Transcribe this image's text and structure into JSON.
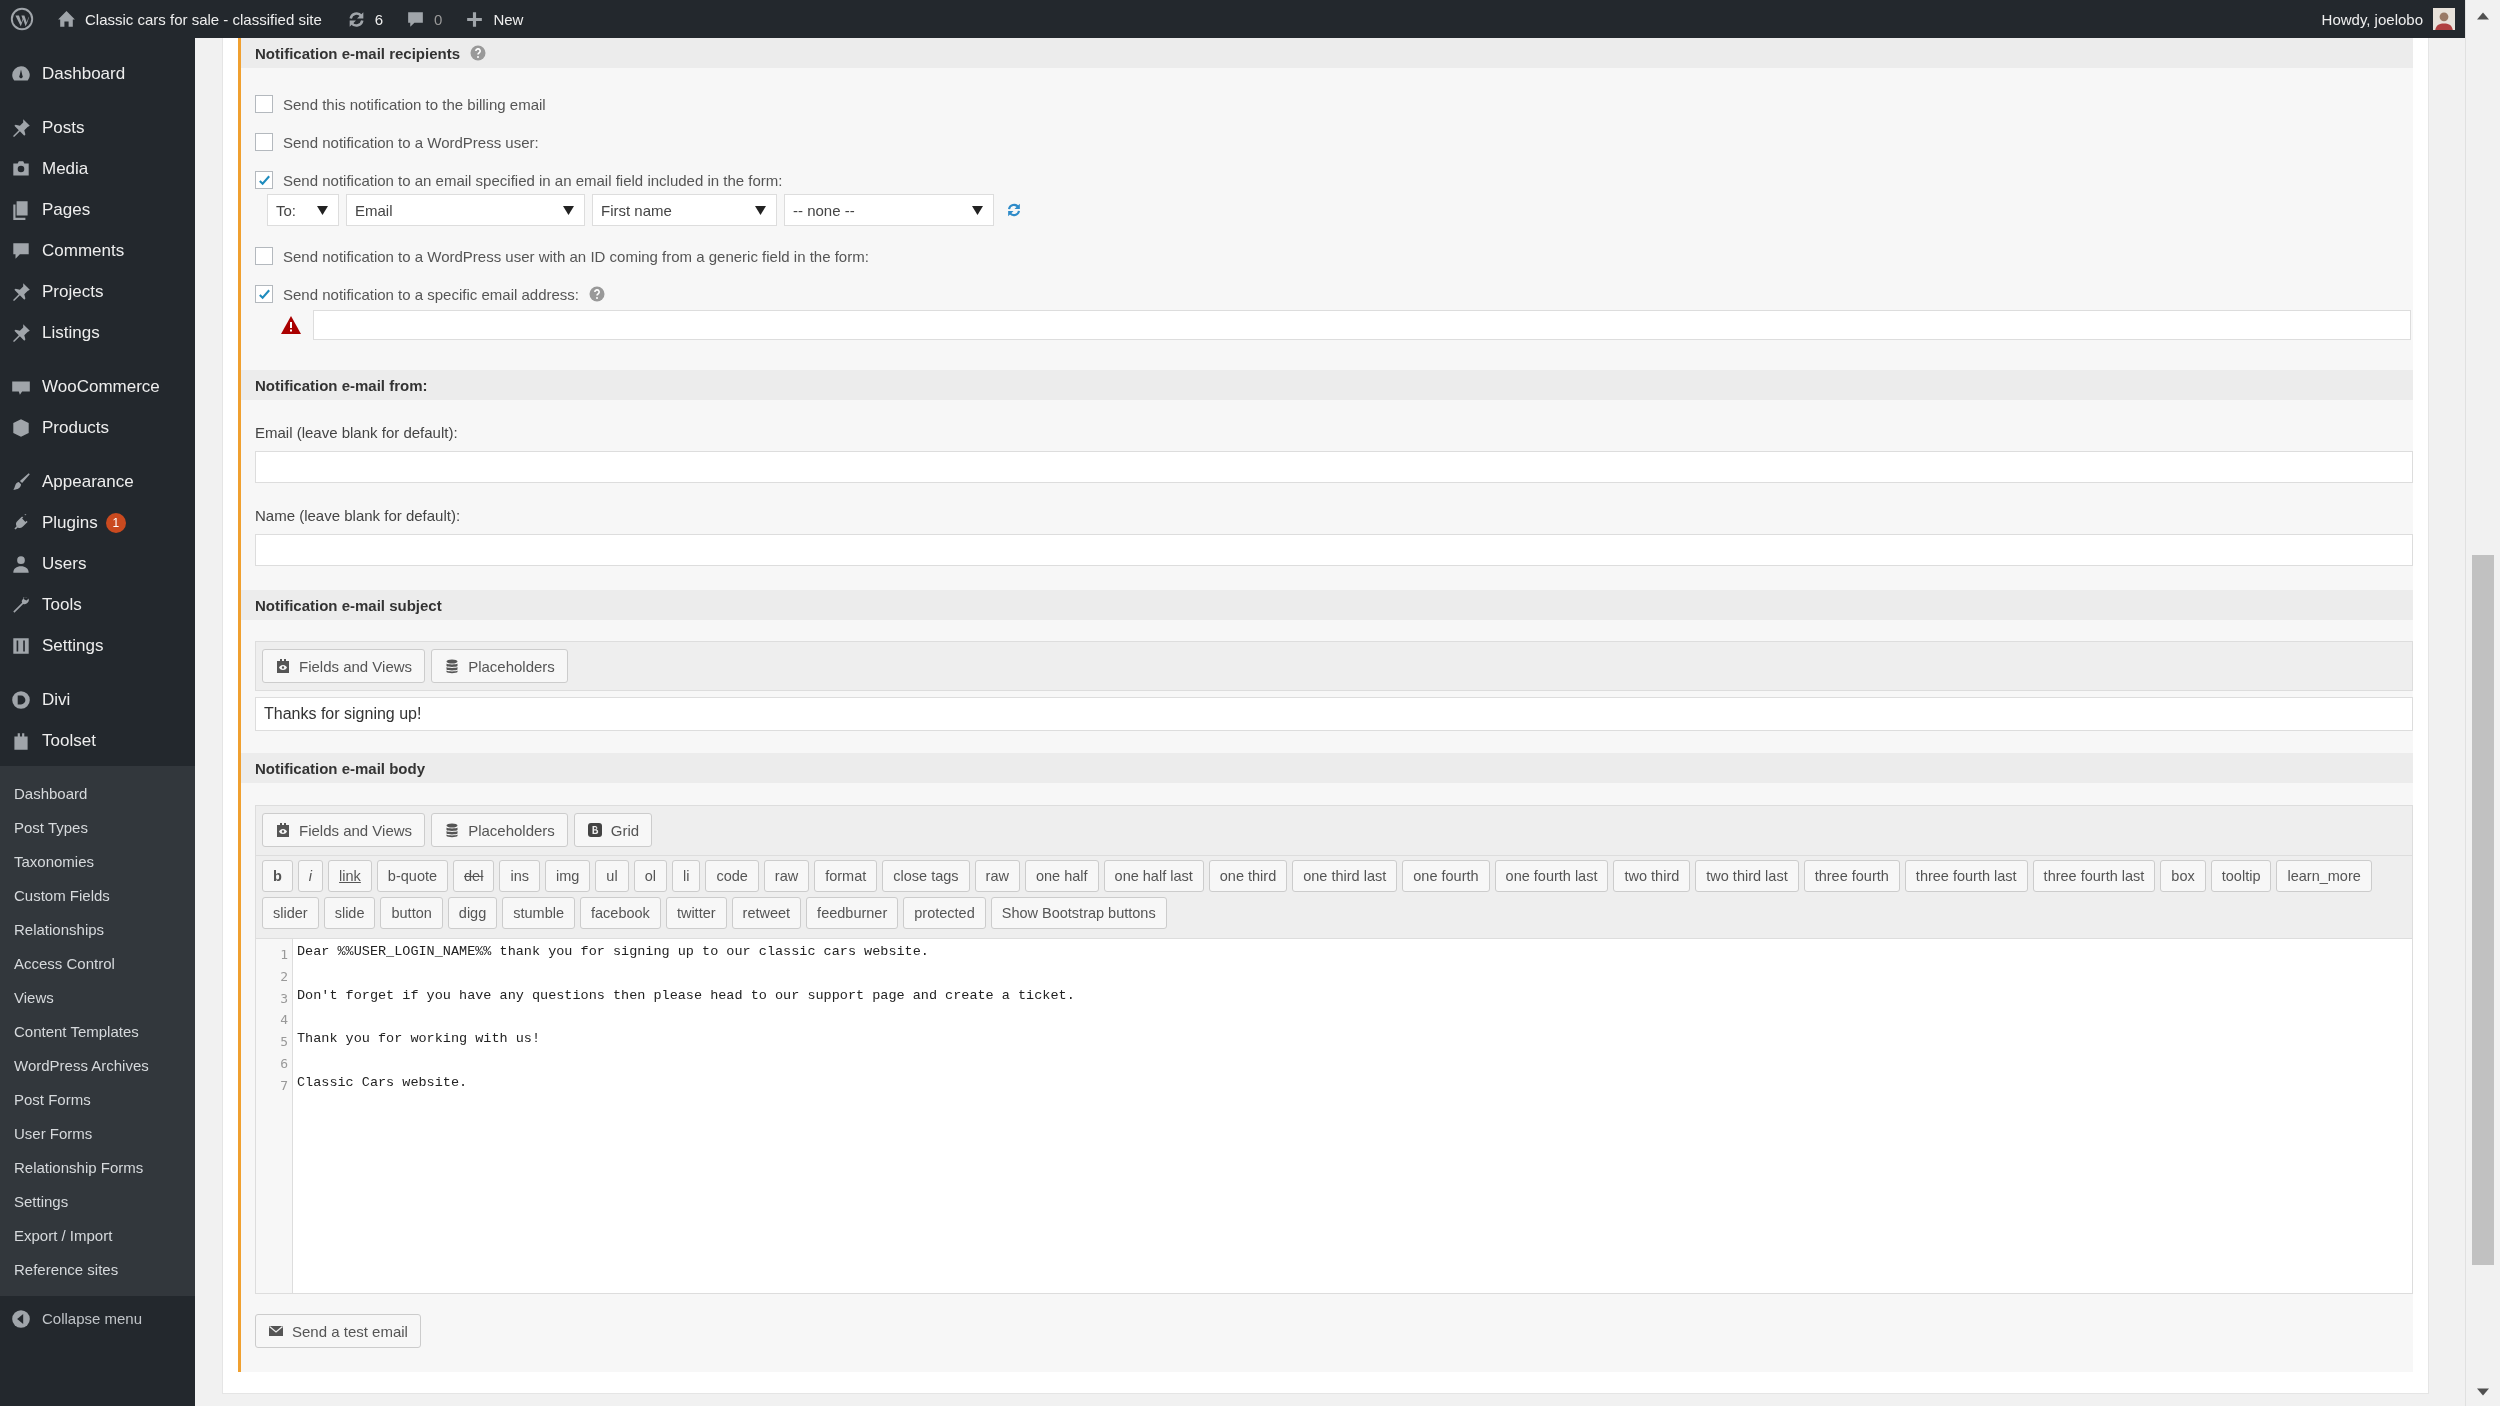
{
  "admin_bar": {
    "site_name": "Classic cars for sale - classified site",
    "updates": "6",
    "comments": "0",
    "new": "New",
    "greeting": "Howdy, joelobo"
  },
  "sidebar": {
    "groups": [
      [
        {
          "label": "Dashboard",
          "kind": "gauge"
        }
      ],
      [
        {
          "label": "Posts",
          "kind": "pin"
        },
        {
          "label": "Media",
          "kind": "camera"
        },
        {
          "label": "Pages",
          "kind": "pages"
        },
        {
          "label": "Comments",
          "kind": "bubble"
        },
        {
          "label": "Projects",
          "kind": "pin"
        },
        {
          "label": "Listings",
          "kind": "pin"
        }
      ],
      [
        {
          "label": "WooCommerce",
          "kind": "label"
        },
        {
          "label": "Products",
          "kind": "cube"
        }
      ],
      [
        {
          "label": "Appearance",
          "kind": "brush"
        },
        {
          "label": "Plugins",
          "kind": "plug",
          "badge": "1"
        },
        {
          "label": "Users",
          "kind": "user"
        },
        {
          "label": "Tools",
          "kind": "wrench"
        },
        {
          "label": "Settings",
          "kind": "sliders"
        }
      ],
      [
        {
          "label": "Divi",
          "kind": "circle"
        },
        {
          "label": "Toolset",
          "kind": "block"
        }
      ]
    ],
    "submenu": [
      "Dashboard",
      "Post Types",
      "Taxonomies",
      "Custom Fields",
      "Relationships",
      "Access Control",
      "Views",
      "Content Templates",
      "WordPress Archives",
      "Post Forms",
      "User Forms",
      "Relationship Forms",
      "Settings",
      "Export / Import",
      "Reference sites"
    ],
    "collapse": "Collapse menu"
  },
  "recipients": {
    "title": "Notification e-mail recipients",
    "options": [
      {
        "label": "Send this notification to the billing email",
        "checked": false,
        "kind": "plain"
      },
      {
        "label": "Send notification to a WordPress user:",
        "checked": false,
        "kind": "plain"
      },
      {
        "label": "Send notification to an email specified in an email field included in the form:",
        "checked": true,
        "kind": "fields",
        "selects": [
          "To:",
          "Email",
          "First name",
          "-- none --"
        ]
      },
      {
        "label": "Send notification to a WordPress user with an ID coming from a generic field in the form:",
        "checked": false,
        "kind": "plain"
      },
      {
        "label": "Send notification to a specific email address:",
        "checked": true,
        "kind": "address"
      }
    ]
  },
  "from": {
    "title": "Notification e-mail from:",
    "fields": [
      {
        "label": "Email (leave blank for default):"
      },
      {
        "label": "Name (leave blank for default):"
      }
    ]
  },
  "subject": {
    "title": "Notification e-mail subject",
    "tools": [
      {
        "label": "Fields and Views",
        "kind": "fields"
      },
      {
        "label": "Placeholders",
        "kind": "placeholders"
      }
    ],
    "value": "Thanks for signing up!"
  },
  "body": {
    "title": "Notification e-mail body",
    "tools": [
      {
        "label": "Fields and Views",
        "kind": "fields"
      },
      {
        "label": "Placeholders",
        "kind": "placeholders"
      },
      {
        "label": "Grid",
        "kind": "grid"
      }
    ],
    "quicktag_rows": [
      [
        {
          "label": "b",
          "kind": "bold"
        },
        {
          "label": "i",
          "kind": "italic"
        },
        {
          "label": "link",
          "kind": "underline"
        },
        {
          "label": "b-quote",
          "kind": "plain"
        },
        {
          "label": "del",
          "kind": "strike"
        },
        {
          "label": "ins",
          "kind": "plain"
        },
        {
          "label": "img",
          "kind": "plain"
        },
        {
          "label": "ul",
          "kind": "plain"
        },
        {
          "label": "ol",
          "kind": "plain"
        },
        {
          "label": "li",
          "kind": "plain"
        },
        {
          "label": "code",
          "kind": "plain"
        },
        {
          "label": "raw",
          "kind": "plain"
        },
        {
          "label": "format",
          "kind": "plain"
        },
        {
          "label": "close tags",
          "kind": "plain"
        },
        {
          "label": "raw",
          "kind": "plain"
        },
        {
          "label": "one half",
          "kind": "plain"
        },
        {
          "label": "one half last",
          "kind": "plain"
        },
        {
          "label": "one third",
          "kind": "plain"
        },
        {
          "label": "one third last",
          "kind": "plain"
        },
        {
          "label": "one fourth",
          "kind": "plain"
        },
        {
          "label": "one fourth last",
          "kind": "plain"
        },
        {
          "label": "two third",
          "kind": "plain"
        },
        {
          "label": "two third last",
          "kind": "plain"
        },
        {
          "label": "three fourth",
          "kind": "plain"
        },
        {
          "label": "three fourth last",
          "kind": "plain"
        },
        {
          "label": "three fourth last",
          "kind": "plain"
        },
        {
          "label": "box",
          "kind": "plain"
        },
        {
          "label": "tooltip",
          "kind": "plain"
        },
        {
          "label": "learn_more",
          "kind": "plain"
        }
      ],
      [
        {
          "label": "slider",
          "kind": "plain"
        },
        {
          "label": "slide",
          "kind": "plain"
        },
        {
          "label": "button",
          "kind": "plain"
        },
        {
          "label": "digg",
          "kind": "plain"
        },
        {
          "label": "stumble",
          "kind": "plain"
        },
        {
          "label": "facebook",
          "kind": "plain"
        },
        {
          "label": "twitter",
          "kind": "plain"
        },
        {
          "label": "retweet",
          "kind": "plain"
        },
        {
          "label": "feedburner",
          "kind": "plain"
        },
        {
          "label": "protected",
          "kind": "plain"
        },
        {
          "label": "Show Bootstrap buttons",
          "kind": "plain"
        }
      ]
    ],
    "lines": [
      {
        "number": "1",
        "text": "Dear %%USER_LOGIN_NAME%% thank you for signing up to our classic cars website."
      },
      {
        "number": "2"
      },
      {
        "number": "3",
        "text": "Don't forget if you have any questions then please head to our support page and create a ticket."
      },
      {
        "number": "4"
      },
      {
        "number": "5",
        "text": "Thank you for working with us!"
      },
      {
        "number": "6"
      },
      {
        "number": "7",
        "text": "Classic Cars website."
      }
    ]
  },
  "send_button": "Send a test email"
}
